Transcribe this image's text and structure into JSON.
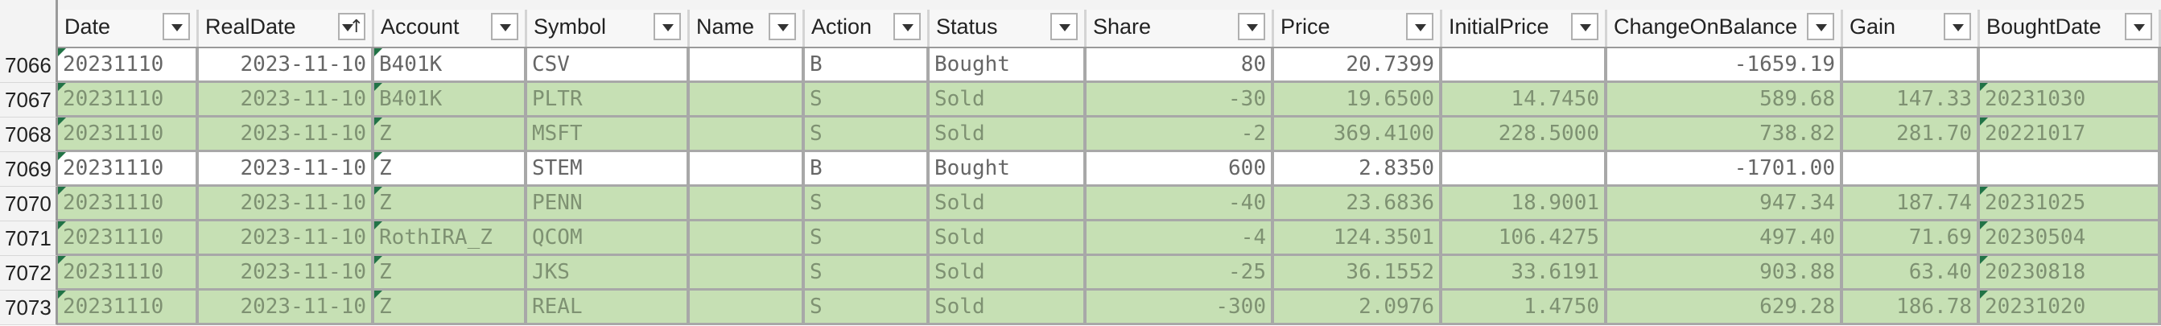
{
  "sheet": {
    "columns": [
      {
        "label": "Date",
        "sorted": false
      },
      {
        "label": "RealDate",
        "sorted": true
      },
      {
        "label": "Account",
        "sorted": false
      },
      {
        "label": "Symbol",
        "sorted": false
      },
      {
        "label": "Name",
        "sorted": false
      },
      {
        "label": "Action",
        "sorted": false
      },
      {
        "label": "Status",
        "sorted": false
      },
      {
        "label": "Share",
        "sorted": false
      },
      {
        "label": "Price",
        "sorted": false
      },
      {
        "label": "InitialPrice",
        "sorted": false
      },
      {
        "label": "ChangeOnBalance",
        "sorted": false
      },
      {
        "label": "Gain",
        "sorted": false
      },
      {
        "label": "BoughtDate",
        "sorted": false
      }
    ],
    "sort_arrow": "↑",
    "rows": [
      {
        "num": "7066",
        "highlight": false,
        "cells": [
          "20231110",
          "2023-11-10",
          "B401K",
          "CSV",
          "",
          "B",
          "Bought",
          "80",
          "20.7399",
          "",
          "-1659.19",
          "",
          ""
        ]
      },
      {
        "num": "7067",
        "highlight": true,
        "cells": [
          "20231110",
          "2023-11-10",
          "B401K",
          "PLTR",
          "",
          "S",
          "Sold",
          "-30",
          "19.6500",
          "14.7450",
          "589.68",
          "147.33",
          "20231030"
        ]
      },
      {
        "num": "7068",
        "highlight": true,
        "cells": [
          "20231110",
          "2023-11-10",
          "Z",
          "MSFT",
          "",
          "S",
          "Sold",
          "-2",
          "369.4100",
          "228.5000",
          "738.82",
          "281.70",
          "20221017"
        ]
      },
      {
        "num": "7069",
        "highlight": false,
        "cells": [
          "20231110",
          "2023-11-10",
          "Z",
          "STEM",
          "",
          "B",
          "Bought",
          "600",
          "2.8350",
          "",
          "-1701.00",
          "",
          ""
        ]
      },
      {
        "num": "7070",
        "highlight": true,
        "cells": [
          "20231110",
          "2023-11-10",
          "Z",
          "PENN",
          "",
          "S",
          "Sold",
          "-40",
          "23.6836",
          "18.9001",
          "947.34",
          "187.74",
          "20231025"
        ]
      },
      {
        "num": "7071",
        "highlight": true,
        "cells": [
          "20231110",
          "2023-11-10",
          "RothIRA_Z",
          "QCOM",
          "",
          "S",
          "Sold",
          "-4",
          "124.3501",
          "106.4275",
          "497.40",
          "71.69",
          "20230504"
        ]
      },
      {
        "num": "7072",
        "highlight": true,
        "cells": [
          "20231110",
          "2023-11-10",
          "Z",
          "JKS",
          "",
          "S",
          "Sold",
          "-25",
          "36.1552",
          "33.6191",
          "903.88",
          "63.40",
          "20230818"
        ]
      },
      {
        "num": "7073",
        "highlight": true,
        "cells": [
          "20231110",
          "2023-11-10",
          "Z",
          "REAL",
          "",
          "S",
          "Sold",
          "-300",
          "2.0976",
          "1.4750",
          "629.28",
          "186.78",
          "20231020"
        ]
      }
    ]
  },
  "colors": {
    "header_bg": "#f3f3f3",
    "highlight_bg": "#c6e0b4",
    "grid_border": "#a8a8a8",
    "flag": "#217346"
  }
}
